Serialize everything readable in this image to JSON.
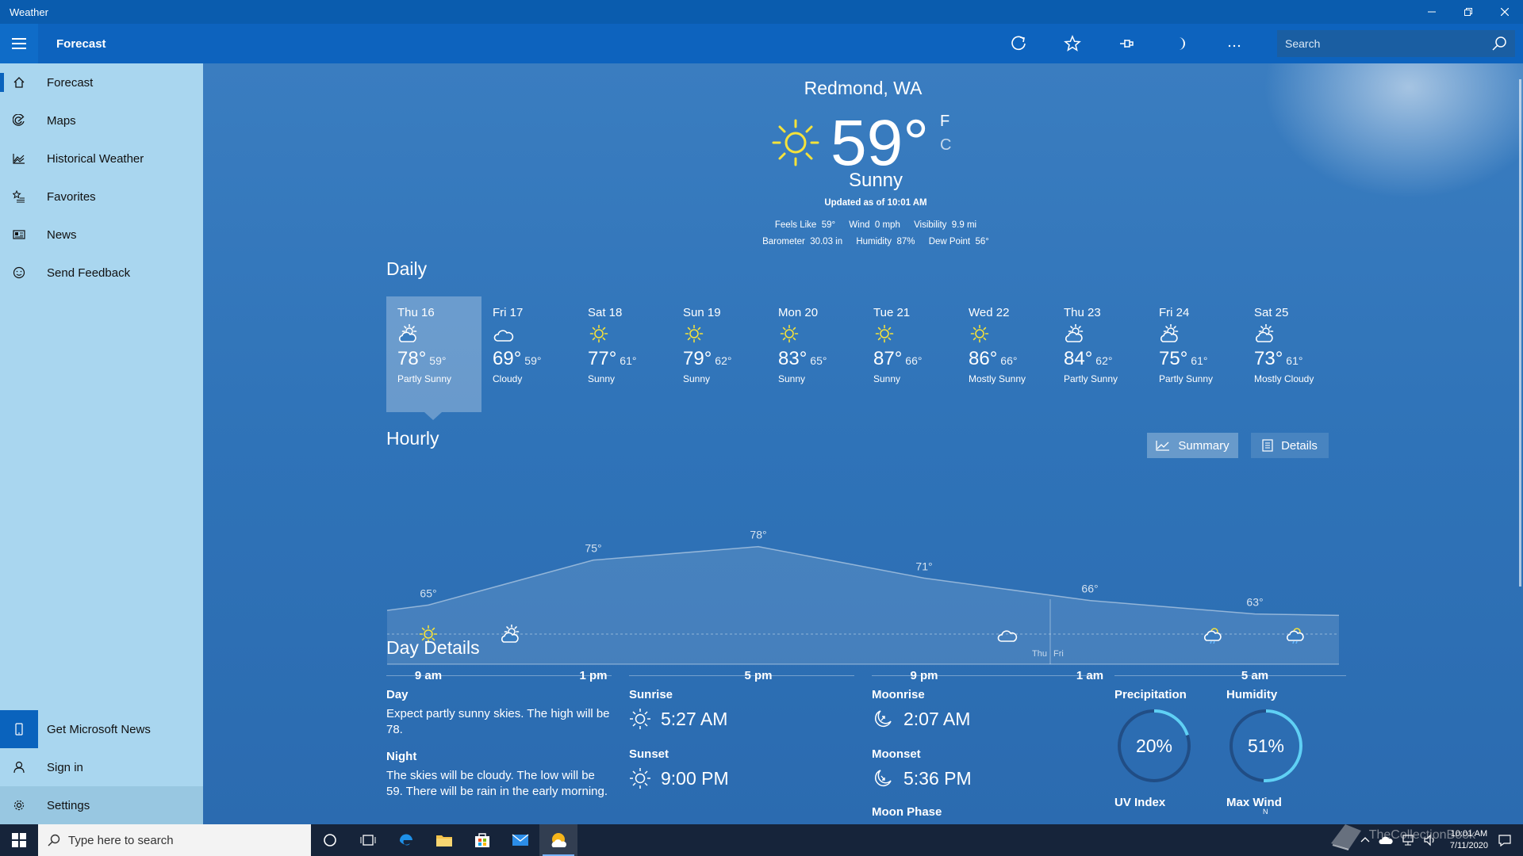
{
  "window": {
    "title": "Weather"
  },
  "appbar": {
    "title": "Forecast",
    "search_placeholder": "Search"
  },
  "sidebar": {
    "items": [
      {
        "label": "Forecast",
        "icon": "home-icon"
      },
      {
        "label": "Maps",
        "icon": "radar-icon"
      },
      {
        "label": "Historical Weather",
        "icon": "chart-icon"
      },
      {
        "label": "Favorites",
        "icon": "star-list-icon"
      },
      {
        "label": "News",
        "icon": "news-icon"
      },
      {
        "label": "Send Feedback",
        "icon": "smiley-icon"
      }
    ],
    "bottom": [
      {
        "label": "Get Microsoft News",
        "icon": "phone-icon"
      },
      {
        "label": "Sign in",
        "icon": "person-icon"
      },
      {
        "label": "Settings",
        "icon": "gear-icon"
      }
    ]
  },
  "current": {
    "location": "Redmond, WA",
    "temp": "59",
    "degree": "°",
    "unit_f": "F",
    "unit_c": "C",
    "condition": "Sunny",
    "updated": "Updated as of 10:01 AM",
    "stats_row1": [
      {
        "label": "Feels Like",
        "value": "59°"
      },
      {
        "label": "Wind",
        "value": "0 mph"
      },
      {
        "label": "Visibility",
        "value": "9.9 mi"
      }
    ],
    "stats_row2": [
      {
        "label": "Barometer",
        "value": "30.03 in"
      },
      {
        "label": "Humidity",
        "value": "87%"
      },
      {
        "label": "Dew Point",
        "value": "56°"
      }
    ]
  },
  "daily": {
    "title": "Daily",
    "days": [
      {
        "day": "Thu 16",
        "hi": "78°",
        "lo": "59°",
        "cond": "Partly Sunny",
        "icon": "partly-sunny-icon"
      },
      {
        "day": "Fri 17",
        "hi": "69°",
        "lo": "59°",
        "cond": "Cloudy",
        "icon": "cloud-icon"
      },
      {
        "day": "Sat 18",
        "hi": "77°",
        "lo": "61°",
        "cond": "Sunny",
        "icon": "sun-icon"
      },
      {
        "day": "Sun 19",
        "hi": "79°",
        "lo": "62°",
        "cond": "Sunny",
        "icon": "sun-icon"
      },
      {
        "day": "Mon 20",
        "hi": "83°",
        "lo": "65°",
        "cond": "Sunny",
        "icon": "sun-icon"
      },
      {
        "day": "Tue 21",
        "hi": "87°",
        "lo": "66°",
        "cond": "Sunny",
        "icon": "sun-icon"
      },
      {
        "day": "Wed 22",
        "hi": "86°",
        "lo": "66°",
        "cond": "Mostly Sunny",
        "icon": "sun-icon"
      },
      {
        "day": "Thu 23",
        "hi": "84°",
        "lo": "62°",
        "cond": "Partly Sunny",
        "icon": "partly-sunny-icon"
      },
      {
        "day": "Fri 24",
        "hi": "75°",
        "lo": "61°",
        "cond": "Partly Sunny",
        "icon": "partly-sunny-icon"
      },
      {
        "day": "Sat 25",
        "hi": "73°",
        "lo": "61°",
        "cond": "Mostly Cloudy",
        "icon": "partly-sunny-icon"
      }
    ]
  },
  "hourly": {
    "title": "Hourly",
    "summary_label": "Summary",
    "details_label": "Details",
    "day_divider": [
      "Thu",
      "Fri"
    ]
  },
  "chart_data": {
    "type": "area",
    "x_ticks": [
      "9 am",
      "1 pm",
      "5 pm",
      "9 pm",
      "1 am",
      "5 am"
    ],
    "temps": [
      {
        "t": "9 am",
        "v": 65
      },
      {
        "t": "1 pm",
        "v": 75
      },
      {
        "t": "5 pm",
        "v": 78
      },
      {
        "t": "9 pm",
        "v": 71
      },
      {
        "t": "1 am",
        "v": 66
      },
      {
        "t": "5 am",
        "v": 63
      }
    ],
    "temp_labels": [
      "65°",
      "75°",
      "78°",
      "71°",
      "66°",
      "63°"
    ],
    "icons": [
      "sun-icon",
      "partly-sunny-icon",
      "cloud-icon",
      "rain-cloud-icon",
      "rain-cloud-icon"
    ],
    "grid": false
  },
  "details": {
    "title": "Day Details",
    "day_label": "Day",
    "day_text": "Expect partly sunny skies. The high will be 78.",
    "night_label": "Night",
    "night_text": "The skies will be cloudy. The low will be 59. There will be rain in the early morning.",
    "sunrise_label": "Sunrise",
    "sunrise": "5:27 AM",
    "sunset_label": "Sunset",
    "sunset": "9:00 PM",
    "moonrise_label": "Moonrise",
    "moonrise": "2:07 AM",
    "moonset_label": "Moonset",
    "moonset": "5:36 PM",
    "moonphase_label": "Moon Phase",
    "precip_label": "Precipitation",
    "precip_value": "20%",
    "precip_fraction": 0.2,
    "humidity_label": "Humidity",
    "humidity_value": "51%",
    "humidity_fraction": 0.51,
    "uv_label": "UV Index",
    "wind_label": "Max Wind",
    "wind_dir": "N"
  },
  "taskbar": {
    "search_placeholder": "Type here to search",
    "time": "10:01 AM",
    "date": "7/11/2020",
    "watermark": "TheCollectionBook"
  },
  "colors": {
    "accent": "#0a63bd",
    "sidebar": "#a9d6ef",
    "sun": "#f5e23a",
    "ring": "#5fd0f5"
  }
}
